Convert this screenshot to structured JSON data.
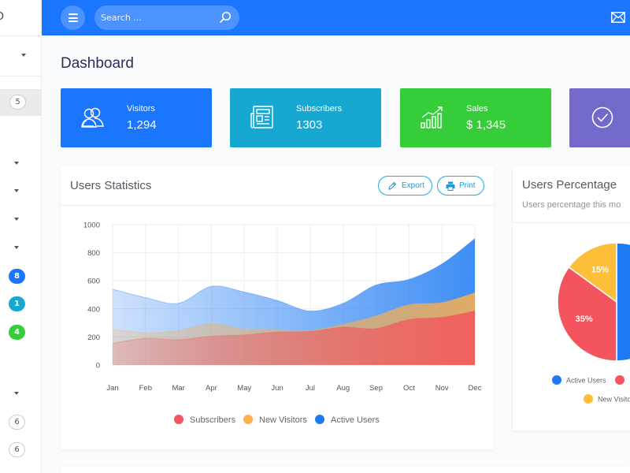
{
  "sidebar": {
    "top_fragment": "D",
    "active_badge": "5",
    "badges": [
      {
        "value": "8",
        "color": "#1a75ff"
      },
      {
        "value": "1",
        "color": "#17a8d2"
      },
      {
        "value": "4",
        "color": "#35cd3a"
      }
    ],
    "outline_badges": [
      "6",
      "6"
    ]
  },
  "topbar": {
    "search_placeholder": "Search ...",
    "accent": "#1a75ff"
  },
  "page": {
    "title": "Dashboard"
  },
  "stats": [
    {
      "label": "Visitors",
      "value": "1,294",
      "icon": "users-icon",
      "color": "#1a75ff"
    },
    {
      "label": "Subscribers",
      "value": "1303",
      "icon": "newspaper-icon",
      "color": "#17a8d2"
    },
    {
      "label": "Sales",
      "value": "$ 1,345",
      "icon": "chart-icon",
      "color": "#35cd3a"
    },
    {
      "label": "",
      "value": "",
      "icon": "check-circle-icon",
      "color": "#716aca"
    }
  ],
  "users_statistics": {
    "title": "Users Statistics",
    "export_label": "Export",
    "print_label": "Print"
  },
  "users_percentage": {
    "title": "Users Percentage",
    "subtitle": "Users percentage this mo",
    "legend": [
      "Active Users",
      "",
      "New Visito"
    ]
  },
  "chart_data": [
    {
      "type": "area",
      "x": [
        "Jan",
        "Feb",
        "Mar",
        "Apr",
        "May",
        "Jun",
        "Jul",
        "Aug",
        "Sep",
        "Oct",
        "Nov",
        "Dec"
      ],
      "ylim": [
        0,
        1000
      ],
      "yticks": [
        0,
        200,
        400,
        600,
        800,
        1000
      ],
      "grid": true,
      "legend_placement": "bottom",
      "series": [
        {
          "name": "Subscribers",
          "color": "#f3545d",
          "values": [
            155,
            190,
            180,
            205,
            215,
            235,
            240,
            270,
            260,
            325,
            340,
            385
          ]
        },
        {
          "name": "New Visitors",
          "color": "#fdaf4b",
          "values": [
            255,
            230,
            245,
            295,
            255,
            250,
            245,
            290,
            350,
            430,
            445,
            515
          ]
        },
        {
          "name": "Active Users",
          "color": "#1d7af3",
          "values": [
            540,
            480,
            440,
            560,
            520,
            460,
            385,
            440,
            570,
            610,
            720,
            900
          ]
        }
      ]
    },
    {
      "type": "pie",
      "slices": [
        {
          "name": "Active Users",
          "value": 50,
          "label": "",
          "color": "#1d7af3"
        },
        {
          "name": "",
          "value": 35,
          "label": "35%",
          "color": "#f3545d"
        },
        {
          "name": "New Visito",
          "value": 15,
          "label": "15%",
          "color": "#fdbe38"
        }
      ]
    }
  ]
}
